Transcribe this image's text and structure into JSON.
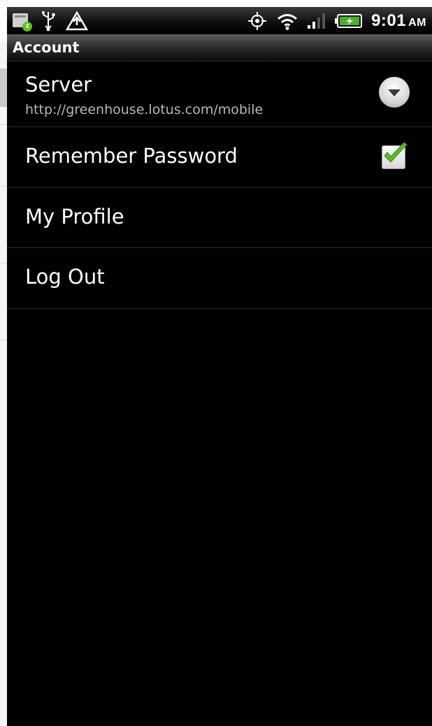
{
  "status_bar": {
    "notification_count": "2",
    "time": "9:01",
    "ampm": "AM",
    "icons": [
      "calendar-notification-icon",
      "usb-icon",
      "warning-icon",
      "gps-icon",
      "wifi-icon",
      "signal-icon",
      "battery-charging-icon"
    ]
  },
  "screen": {
    "title": "Account"
  },
  "settings": [
    {
      "title": "Server",
      "subtitle": "http://greenhouse.lotus.com/mobile",
      "widget": "dropdown-icon"
    },
    {
      "title": "Remember Password",
      "checked": true,
      "widget": "checkbox"
    },
    {
      "title": "My Profile"
    },
    {
      "title": "Log Out"
    }
  ],
  "colors": {
    "background": "#000000",
    "text": "#ffffff",
    "subtext": "#b8b8b8",
    "check_green": "#5cb82a",
    "badge_green": "#5cc21d"
  }
}
